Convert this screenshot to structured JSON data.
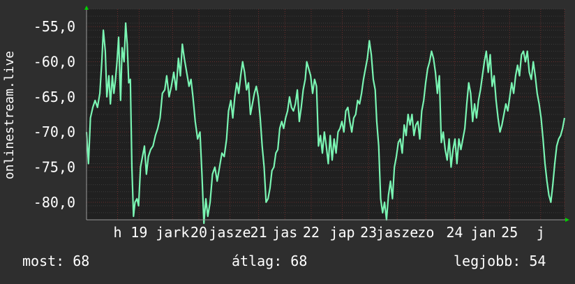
{
  "chart_data": {
    "type": "line",
    "ylabel": "onlinestream.live",
    "ylim": [
      -82.5,
      -52.5
    ],
    "ytick_values": [
      -55,
      -60,
      -65,
      -70,
      -75,
      -80
    ],
    "ytick_labels": [
      "-55,0",
      "-60,0",
      "-65,0",
      "-70,0",
      "-75,0",
      "-80,0"
    ],
    "xlim": [
      0,
      100
    ],
    "xtick_values": [
      6.5,
      11,
      18,
      23.5,
      30,
      36,
      41.5,
      47,
      53.5,
      59,
      65,
      71,
      77,
      83,
      88.5,
      95,
      100
    ],
    "xtick_labels": [
      "h",
      "19",
      "jark",
      "20",
      "jasze",
      "21",
      "jas",
      "22",
      "jap",
      "23",
      "jasze",
      "zo",
      "24",
      "jan",
      "25",
      "j",
      ""
    ],
    "grid": true,
    "colors": {
      "background": "#2e2e2e",
      "plot_bg": "#202020",
      "line": "#7af5b3",
      "grid_major": "#6a2d2d",
      "grid_minor": "#3c3c3c",
      "arrow": "#00d000"
    },
    "series": [
      {
        "values": [
          [
            0.0,
            -70.0
          ],
          [
            0.5,
            -74.5
          ],
          [
            1.0,
            -68.0
          ],
          [
            1.6,
            -66.5
          ],
          [
            2.2,
            -65.5
          ],
          [
            2.8,
            -66.5
          ],
          [
            3.4,
            -64.5
          ],
          [
            3.9,
            -60.0
          ],
          [
            4.3,
            -55.5
          ],
          [
            4.8,
            -58.5
          ],
          [
            5.2,
            -65.0
          ],
          [
            5.7,
            -62.0
          ],
          [
            6.1,
            -66.0
          ],
          [
            6.6,
            -62.0
          ],
          [
            7.0,
            -64.5
          ],
          [
            7.4,
            -62.5
          ],
          [
            7.8,
            -60.0
          ],
          [
            8.2,
            -56.5
          ],
          [
            8.7,
            -65.5
          ],
          [
            9.1,
            -58.0
          ],
          [
            9.6,
            -60.0
          ],
          [
            10.0,
            -54.5
          ],
          [
            10.4,
            -57.5
          ],
          [
            10.8,
            -63.0
          ],
          [
            11.2,
            -62.5
          ],
          [
            11.6,
            -75.0
          ],
          [
            12.0,
            -82.0
          ],
          [
            12.4,
            -80.0
          ],
          [
            12.9,
            -79.5
          ],
          [
            13.3,
            -80.5
          ],
          [
            13.8,
            -75.0
          ],
          [
            14.3,
            -73.5
          ],
          [
            14.8,
            -72.0
          ],
          [
            15.3,
            -76.0
          ],
          [
            15.8,
            -73.5
          ],
          [
            16.4,
            -72.5
          ],
          [
            17.0,
            -72.0
          ],
          [
            17.6,
            -70.5
          ],
          [
            18.2,
            -69.5
          ],
          [
            18.8,
            -68.0
          ],
          [
            19.4,
            -64.5
          ],
          [
            20.0,
            -64.0
          ],
          [
            20.5,
            -62.0
          ],
          [
            21.1,
            -65.0
          ],
          [
            21.7,
            -63.5
          ],
          [
            22.3,
            -61.5
          ],
          [
            22.9,
            -64.0
          ],
          [
            23.5,
            -59.5
          ],
          [
            24.0,
            -62.0
          ],
          [
            24.5,
            -57.5
          ],
          [
            25.0,
            -59.5
          ],
          [
            25.6,
            -61.5
          ],
          [
            26.2,
            -63.5
          ],
          [
            26.7,
            -62.5
          ],
          [
            27.2,
            -65.0
          ],
          [
            27.8,
            -68.5
          ],
          [
            28.4,
            -71.0
          ],
          [
            29.0,
            -70.0
          ],
          [
            29.5,
            -76.0
          ],
          [
            30.0,
            -83.0
          ],
          [
            30.5,
            -79.5
          ],
          [
            31.0,
            -82.0
          ],
          [
            31.6,
            -80.0
          ],
          [
            32.2,
            -76.0
          ],
          [
            32.8,
            -75.0
          ],
          [
            33.4,
            -77.0
          ],
          [
            34.0,
            -75.0
          ],
          [
            34.6,
            -73.0
          ],
          [
            35.2,
            -73.5
          ],
          [
            35.8,
            -71.0
          ],
          [
            36.3,
            -67.0
          ],
          [
            36.9,
            -65.5
          ],
          [
            37.4,
            -68.0
          ],
          [
            37.9,
            -65.0
          ],
          [
            38.4,
            -63.0
          ],
          [
            38.9,
            -64.5
          ],
          [
            39.4,
            -62.0
          ],
          [
            39.9,
            -60.0
          ],
          [
            40.4,
            -61.5
          ],
          [
            40.9,
            -64.0
          ],
          [
            41.4,
            -63.0
          ],
          [
            41.9,
            -67.5
          ],
          [
            42.4,
            -66.0
          ],
          [
            42.9,
            -64.5
          ],
          [
            43.4,
            -63.5
          ],
          [
            43.9,
            -65.0
          ],
          [
            44.4,
            -68.0
          ],
          [
            44.9,
            -72.0
          ],
          [
            45.4,
            -75.0
          ],
          [
            45.9,
            -80.0
          ],
          [
            46.4,
            -79.5
          ],
          [
            46.9,
            -78.0
          ],
          [
            47.4,
            -75.5
          ],
          [
            47.9,
            -75.0
          ],
          [
            48.4,
            -73.0
          ],
          [
            48.9,
            -72.5
          ],
          [
            49.4,
            -69.5
          ],
          [
            49.9,
            -68.5
          ],
          [
            50.4,
            -69.5
          ],
          [
            50.9,
            -68.0
          ],
          [
            51.4,
            -67.0
          ],
          [
            51.9,
            -65.0
          ],
          [
            52.4,
            -66.5
          ],
          [
            52.9,
            -67.0
          ],
          [
            53.4,
            -66.0
          ],
          [
            53.9,
            -64.0
          ],
          [
            54.4,
            -68.5
          ],
          [
            54.9,
            -66.5
          ],
          [
            55.4,
            -64.0
          ],
          [
            55.9,
            -62.5
          ],
          [
            56.3,
            -60.0
          ],
          [
            56.8,
            -61.0
          ],
          [
            57.3,
            -62.0
          ],
          [
            57.8,
            -64.5
          ],
          [
            58.3,
            -62.5
          ],
          [
            58.8,
            -63.5
          ],
          [
            59.3,
            -72.0
          ],
          [
            59.8,
            -70.5
          ],
          [
            60.3,
            -73.0
          ],
          [
            60.8,
            -70.0
          ],
          [
            61.3,
            -72.0
          ],
          [
            61.8,
            -74.5
          ],
          [
            62.3,
            -70.5
          ],
          [
            62.8,
            -74.0
          ],
          [
            63.3,
            -71.0
          ],
          [
            63.8,
            -73.0
          ],
          [
            64.3,
            -70.0
          ],
          [
            64.8,
            -69.5
          ],
          [
            65.3,
            -68.5
          ],
          [
            65.8,
            -70.0
          ],
          [
            66.3,
            -67.0
          ],
          [
            66.8,
            -66.5
          ],
          [
            67.3,
            -68.5
          ],
          [
            67.8,
            -70.0
          ],
          [
            68.3,
            -68.0
          ],
          [
            68.8,
            -67.5
          ],
          [
            69.3,
            -65.5
          ],
          [
            69.8,
            -66.0
          ],
          [
            70.3,
            -64.5
          ],
          [
            70.8,
            -62.5
          ],
          [
            71.3,
            -61.0
          ],
          [
            71.8,
            -59.5
          ],
          [
            72.3,
            -57.0
          ],
          [
            72.8,
            -59.0
          ],
          [
            73.3,
            -62.5
          ],
          [
            73.8,
            -64.0
          ],
          [
            74.2,
            -68.5
          ],
          [
            74.7,
            -72.0
          ],
          [
            75.2,
            -79.5
          ],
          [
            75.7,
            -81.5
          ],
          [
            76.2,
            -80.0
          ],
          [
            76.7,
            -82.5
          ],
          [
            77.2,
            -79.0
          ],
          [
            77.7,
            -77.0
          ],
          [
            78.2,
            -79.5
          ],
          [
            78.7,
            -75.0
          ],
          [
            79.2,
            -73.5
          ],
          [
            79.7,
            -71.5
          ],
          [
            80.2,
            -71.0
          ],
          [
            80.7,
            -73.0
          ],
          [
            81.2,
            -69.0
          ],
          [
            81.7,
            -70.5
          ],
          [
            82.2,
            -67.5
          ],
          [
            82.7,
            -69.0
          ],
          [
            83.2,
            -67.5
          ],
          [
            83.7,
            -70.5
          ],
          [
            84.2,
            -69.0
          ],
          [
            84.7,
            -68.5
          ],
          [
            85.2,
            -71.0
          ],
          [
            85.7,
            -67.0
          ],
          [
            86.2,
            -65.5
          ],
          [
            86.7,
            -63.0
          ],
          [
            87.2,
            -61.0
          ],
          [
            87.7,
            -60.0
          ],
          [
            88.2,
            -58.5
          ],
          [
            88.7,
            -59.5
          ],
          [
            89.2,
            -61.5
          ],
          [
            89.7,
            -64.5
          ],
          [
            90.2,
            -62.0
          ],
          [
            90.7,
            -71.5
          ],
          [
            91.2,
            -70.0
          ],
          [
            91.7,
            -72.5
          ],
          [
            92.2,
            -74.0
          ],
          [
            92.7,
            -71.0
          ],
          [
            93.2,
            -75.0
          ],
          [
            93.7,
            -72.5
          ],
          [
            94.2,
            -71.0
          ],
          [
            94.7,
            -74.5
          ],
          [
            95.2,
            -71.0
          ],
          [
            95.7,
            -72.5
          ],
          [
            96.2,
            -71.0
          ],
          [
            96.7,
            -69.5
          ],
          [
            97.2,
            -66.0
          ],
          [
            97.7,
            -63.0
          ],
          [
            98.2,
            -64.5
          ],
          [
            98.7,
            -68.5
          ],
          [
            99.2,
            -66.0
          ],
          [
            99.7,
            -68.0
          ],
          [
            100.2,
            -65.5
          ],
          [
            100.7,
            -64.0
          ],
          [
            101.2,
            -62.0
          ],
          [
            101.7,
            -60.0
          ],
          [
            102.2,
            -58.5
          ],
          [
            102.7,
            -61.5
          ],
          [
            103.2,
            -59.0
          ],
          [
            103.7,
            -63.5
          ],
          [
            104.2,
            -62.0
          ],
          [
            104.7,
            -65.5
          ],
          [
            105.2,
            -68.0
          ],
          [
            105.7,
            -70.0
          ],
          [
            106.2,
            -69.0
          ],
          [
            106.7,
            -67.5
          ],
          [
            107.2,
            -66.0
          ],
          [
            107.7,
            -67.0
          ],
          [
            108.2,
            -65.0
          ],
          [
            108.7,
            -63.0
          ],
          [
            109.2,
            -64.5
          ],
          [
            109.7,
            -62.0
          ],
          [
            110.2,
            -60.5
          ],
          [
            110.7,
            -62.0
          ],
          [
            111.2,
            -59.0
          ],
          [
            111.7,
            -58.5
          ],
          [
            112.2,
            -60.0
          ],
          [
            112.7,
            -58.5
          ],
          [
            113.2,
            -61.5
          ],
          [
            113.7,
            -62.5
          ],
          [
            114.2,
            -60.0
          ],
          [
            114.7,
            -62.0
          ],
          [
            115.2,
            -64.5
          ],
          [
            115.7,
            -66.0
          ],
          [
            116.2,
            -68.0
          ],
          [
            116.7,
            -71.0
          ],
          [
            117.2,
            -74.5
          ],
          [
            117.7,
            -77.0
          ],
          [
            118.2,
            -79.0
          ],
          [
            118.7,
            -80.0
          ],
          [
            119.2,
            -77.5
          ],
          [
            119.7,
            -74.5
          ],
          [
            120.2,
            -72.0
          ],
          [
            120.7,
            -71.0
          ],
          [
            121.2,
            -70.5
          ],
          [
            121.7,
            -69.5
          ],
          [
            122.2,
            -68.0
          ]
        ]
      }
    ]
  },
  "stats": {
    "current_label": "most:",
    "current_value": "68",
    "average_label": "átlag:",
    "average_value": "68",
    "best_label": "legjobb:",
    "best_value": "54"
  }
}
